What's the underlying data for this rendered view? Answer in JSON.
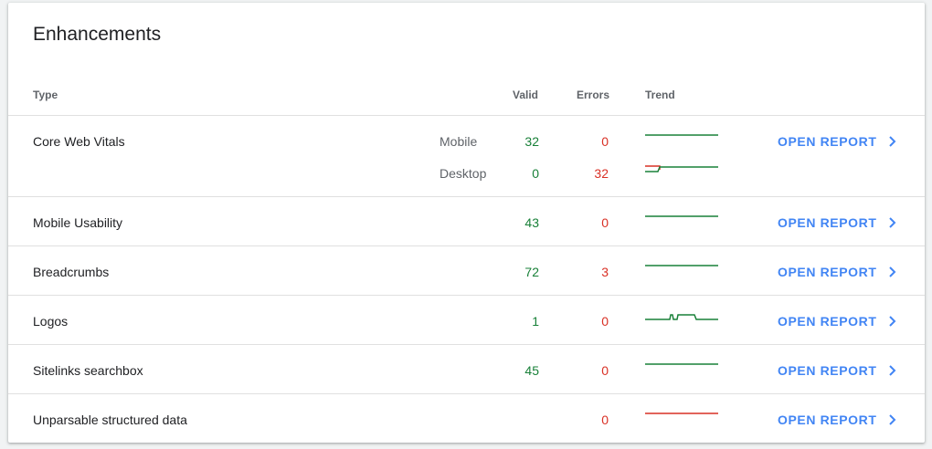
{
  "card": {
    "title": "Enhancements"
  },
  "columns": {
    "type": "Type",
    "valid": "Valid",
    "errors": "Errors",
    "trend": "Trend"
  },
  "rows": [
    {
      "type": "Core Web Vitals",
      "sub": [
        {
          "device": "Mobile",
          "valid": "32",
          "errors": "0"
        },
        {
          "device": "Desktop",
          "valid": "0",
          "errors": "32"
        }
      ],
      "open_label": "OPEN REPORT"
    },
    {
      "type": "Mobile Usability",
      "valid": "43",
      "errors": "0",
      "open_label": "OPEN REPORT"
    },
    {
      "type": "Breadcrumbs",
      "valid": "72",
      "errors": "3",
      "open_label": "OPEN REPORT"
    },
    {
      "type": "Logos",
      "valid": "1",
      "errors": "0",
      "open_label": "OPEN REPORT"
    },
    {
      "type": "Sitelinks searchbox",
      "valid": "45",
      "errors": "0",
      "open_label": "OPEN REPORT"
    },
    {
      "type": "Unparsable structured data",
      "valid": "",
      "errors": "0",
      "open_label": "OPEN REPORT"
    }
  ],
  "colors": {
    "valid": "#188038",
    "errors": "#d93025",
    "link": "#4285f4"
  },
  "icons": {
    "open": "chevron-right-icon"
  }
}
